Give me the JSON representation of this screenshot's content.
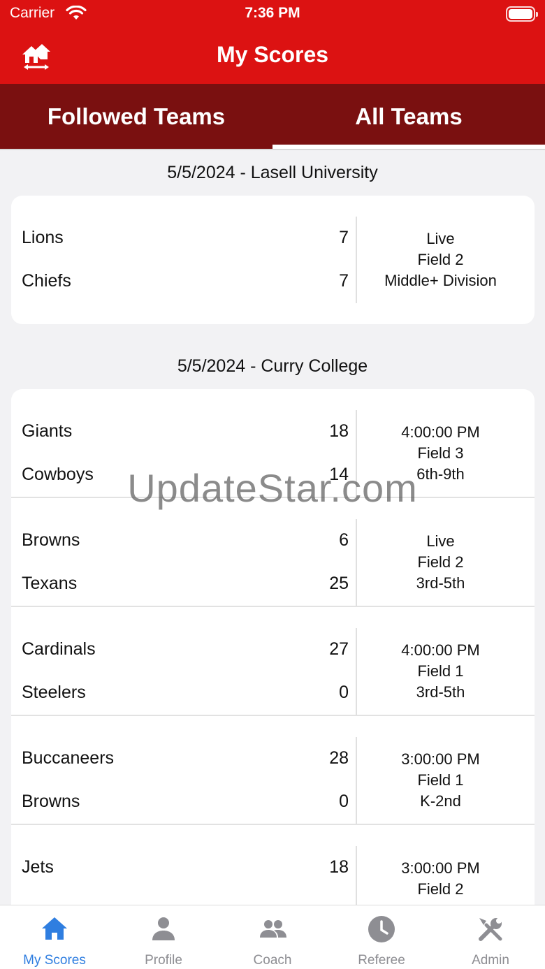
{
  "status": {
    "carrier": "Carrier",
    "time": "7:36 PM"
  },
  "nav": {
    "title": "My Scores"
  },
  "tabs": {
    "followed": "Followed Teams",
    "all": "All Teams"
  },
  "sections": [
    {
      "header": "5/5/2024 - Lasell University",
      "games": [
        {
          "team1": "Lions",
          "score1": "7",
          "team2": "Chiefs",
          "score2": "7",
          "status": "Live",
          "field": "Field 2",
          "division": "Middle+ Division"
        }
      ]
    },
    {
      "header": "5/5/2024 - Curry College",
      "games": [
        {
          "team1": "Giants",
          "score1": "18",
          "team2": "Cowboys",
          "score2": "14",
          "status": "4:00:00 PM",
          "field": "Field 3",
          "division": "6th-9th"
        },
        {
          "team1": "Browns",
          "score1": "6",
          "team2": "Texans",
          "score2": "25",
          "status": "Live",
          "field": "Field 2",
          "division": "3rd-5th"
        },
        {
          "team1": "Cardinals",
          "score1": "27",
          "team2": "Steelers",
          "score2": "0",
          "status": "4:00:00 PM",
          "field": "Field 1",
          "division": "3rd-5th"
        },
        {
          "team1": "Buccaneers",
          "score1": "28",
          "team2": "Browns",
          "score2": "0",
          "status": "3:00:00 PM",
          "field": "Field 1",
          "division": "K-2nd"
        },
        {
          "team1": "Jets",
          "score1": "18",
          "team2": "",
          "score2": "",
          "status": "3:00:00 PM",
          "field": "Field 2",
          "division": ""
        }
      ]
    }
  ],
  "watermark": "UpdateStar.com",
  "bottom_nav": [
    {
      "label": "My Scores",
      "icon": "home-icon",
      "active": true
    },
    {
      "label": "Profile",
      "icon": "person-icon",
      "active": false
    },
    {
      "label": "Coach",
      "icon": "people-icon",
      "active": false
    },
    {
      "label": "Referee",
      "icon": "clock-icon",
      "active": false
    },
    {
      "label": "Admin",
      "icon": "tools-icon",
      "active": false
    }
  ],
  "colors": {
    "brand_red": "#dc1212",
    "tab_bar": "#7a1010",
    "active_blue": "#2f7ee0",
    "inactive_gray": "#8e8e93"
  }
}
